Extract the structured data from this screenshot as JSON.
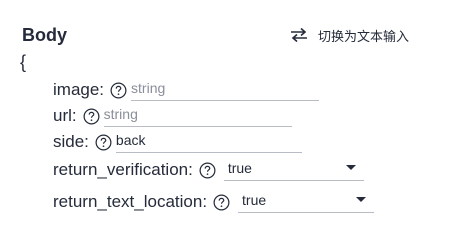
{
  "section": {
    "title": "Body",
    "switch_label": "切换为文本输入",
    "open_brace": "{"
  },
  "fields": {
    "image": {
      "label": "image:",
      "value": "",
      "placeholder": "string"
    },
    "url": {
      "label": "url:",
      "value": "",
      "placeholder": "string"
    },
    "side": {
      "label": "side:",
      "value": "back",
      "placeholder": ""
    },
    "return_verification": {
      "label": "return_verification:",
      "selected": "true"
    },
    "return_text_location": {
      "label": "return_text_location:",
      "selected": "true"
    }
  },
  "icons": {
    "switch": "swap-arrows-icon",
    "help": "question-circle-icon",
    "caret": "caret-down-icon"
  },
  "colors": {
    "text": "#252b3a",
    "placeholder": "#8a8e99",
    "underline": "#b9bcc4"
  }
}
